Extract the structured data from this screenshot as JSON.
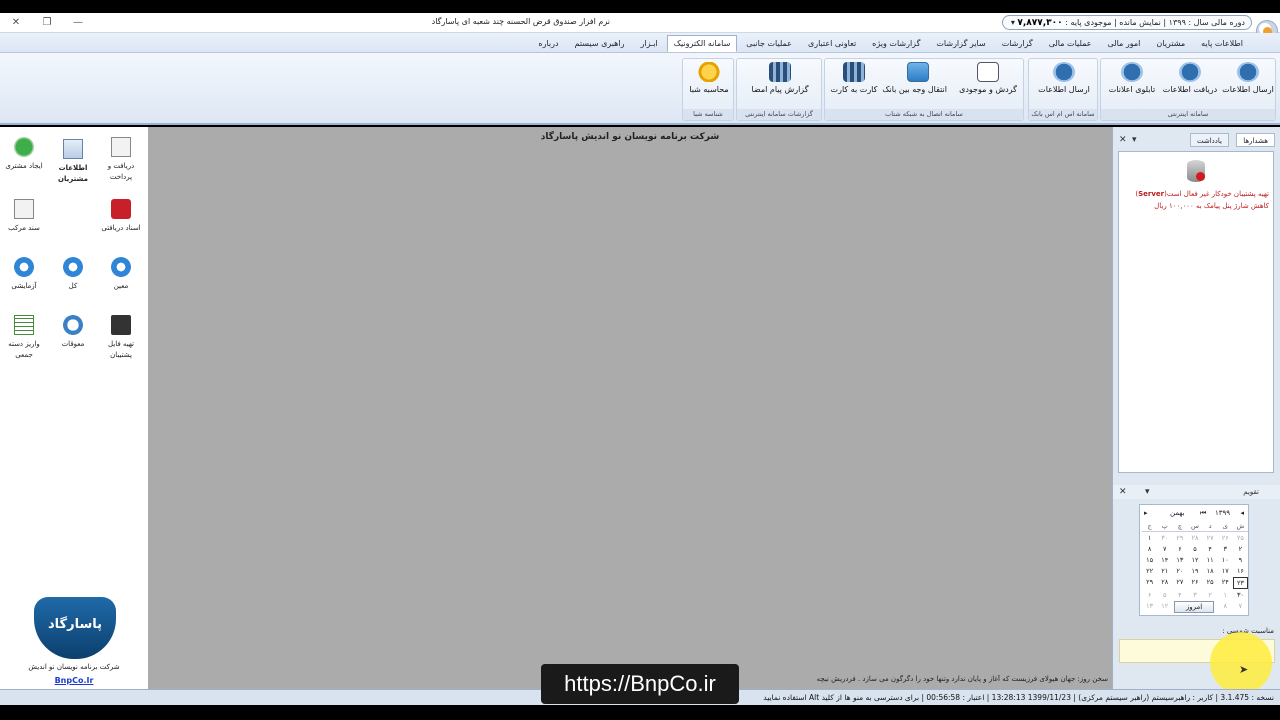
{
  "window": {
    "title": "نرم افزار صندوق قرض الحسنه چند شعبه ای پاسارگاد",
    "close": "✕",
    "restore": "❐",
    "minimize": "—",
    "period": "دوره مالی سال : ۱۳۹۹ | نمایش مانده | موجودی پایه :",
    "balance": "۷,۸۷۷,۳۰۰",
    "dropdown": "▾"
  },
  "tabs": [
    "اطلاعات پایه",
    "مشتریان",
    "امور مالی",
    "عملیات مالی",
    "گزارشات",
    "سایر گزارشات",
    "گزارشات ویژه",
    "تعاونی اعتباری",
    "عملیات جانبی",
    "سامانه الکترونیک",
    "ابـزار",
    "راهبری سیستم",
    "درباره"
  ],
  "ribbon": {
    "groups": [
      {
        "label": "سامانه اینترنتی",
        "buttons": [
          "ارسال اطلاعات",
          "دریافت اطلاعات",
          "تابلوی اعلانات"
        ]
      },
      {
        "label": "سامانه اس ام اس بانک",
        "buttons": [
          "ارسال اطلاعات"
        ]
      },
      {
        "label": "سامانه اتصال به شبکه شتاب",
        "buttons": [
          "گردش و موجودی",
          "انتقال وجه بین بانک",
          "کارت به کارت"
        ]
      },
      {
        "label": "گزارشات سامانه اینترنتی",
        "buttons": [
          "گزارش پیام امضا"
        ]
      },
      {
        "label": "شناسه شبا",
        "buttons": [
          "محاسبه شبا"
        ]
      }
    ]
  },
  "main": {
    "company_header": "شرکت برنامه نویسان نو اندیش پاسارگاد"
  },
  "shortcuts": [
    {
      "label": "دریافت و پرداخت"
    },
    {
      "label": "اطلاعات مشتریان"
    },
    {
      "label": "ایجاد مشتری"
    },
    {
      "label": "اسناد دریافتی"
    },
    {
      "label": "سند مرکب"
    },
    {
      "label": "معین"
    },
    {
      "label": "کل"
    },
    {
      "label": "آزمایشی"
    },
    {
      "label": "تهیه فایل پشتیبان"
    },
    {
      "label": "معوقات"
    },
    {
      "label": "واریز دسته جمعی"
    }
  ],
  "logo": {
    "text": "پاسارگاد"
  },
  "company_footer": "شرکت برنامه نویسان نو اندیش",
  "company_link": "BnpCo.Ir",
  "panel": {
    "tabs": [
      "هشدارها",
      "یادداشت"
    ],
    "close": "✕",
    "pin": "▾",
    "alert_1_prefix": "تهیه پشتیبان خودکار غیر فعال است(",
    "alert_1_server": "Server",
    "alert_1_suffix": ")",
    "alert_2": "کاهش شارژ پنل پیامک به ۱۰۰,۰۰۰ ریال"
  },
  "calendar": {
    "title": "تقویم",
    "year": "۱۳۹۹",
    "month": "بهمن",
    "weekdays": [
      "ش",
      "ی",
      "د",
      "س",
      "چ",
      "پ",
      "ج"
    ],
    "days": [
      [
        "۲۵",
        "۲۶",
        "۲۷",
        "۲۸",
        "۲۹",
        "۳۰",
        "۱"
      ],
      [
        "۲",
        "۳",
        "۴",
        "۵",
        "۶",
        "۷",
        "۸"
      ],
      [
        "۹",
        "۱۰",
        "۱۱",
        "۱۲",
        "۱۳",
        "۱۴",
        "۱۵"
      ],
      [
        "۱۶",
        "۱۷",
        "۱۸",
        "۱۹",
        "۲۰",
        "۲۱",
        "۲۲"
      ],
      [
        "۲۳",
        "۲۴",
        "۲۵",
        "۲۶",
        "۲۷",
        "۲۸",
        "۲۹"
      ],
      [
        "۳۰",
        "۱",
        "۲",
        "۳",
        "۴",
        "۵",
        "۶"
      ],
      [
        "۷",
        "۸",
        "۹",
        "۱۰",
        "۱۱",
        "۱۲",
        "۱۳"
      ]
    ],
    "today_button": "امروز",
    "occasion_label": "مناسبت شمسی :"
  },
  "saying": "سخن روز: جهان هیولای فرزیست که آغاز و پایان ندارد وتنها خود را دگرگون می سازد . فردریش نیچه",
  "statusbar": "نسخه : 3.1.475 | کاربر : راهبرسیستم (راهبر سیستم مرکزی) | 1399/11/23 13:28:13 | اعتبار : 00:56:58 | برای دسترسی به منو ها از کلید Alt استفاده نمایید",
  "watermark": "https://BnpCo.ir"
}
